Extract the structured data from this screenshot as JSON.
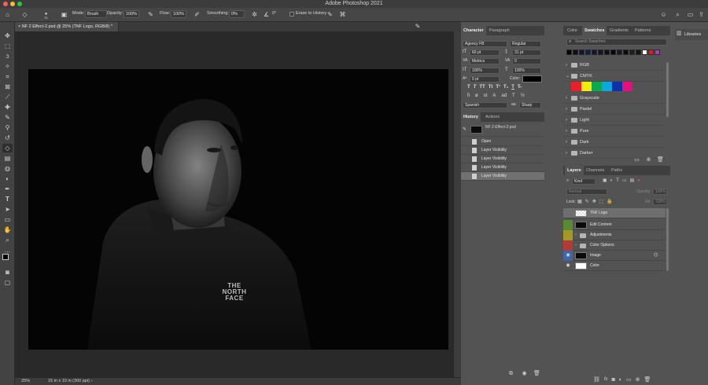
{
  "app": {
    "title": "Adobe Photoshop 2021"
  },
  "options_bar": {
    "brush_size": "70",
    "mode_label": "Mode:",
    "mode_value": "Brush",
    "opacity_label": "Opacity:",
    "opacity_value": "100%",
    "flow_label": "Flow:",
    "flow_value": "100%",
    "smoothing_label": "Smoothing:",
    "smoothing_value": "0%",
    "angle_value": "0°",
    "erase_to_history": "Erase to History"
  },
  "document": {
    "tab_title": "NF 2 Effect-2.psd @ 25% (TNF Logo, RGB/8) *",
    "zoom": "25%",
    "doc_size": "15 in x 10 in (300 ppi)",
    "logo_line1": "THE",
    "logo_line2": "NORTH",
    "logo_line3": "FACE"
  },
  "character_panel": {
    "tabs": [
      "Character",
      "Paragraph"
    ],
    "font_family": "Agency FB",
    "font_style": "Regular",
    "font_size": "60 pt",
    "leading": "31 pt",
    "kerning": "Metrics",
    "tracking": "0",
    "vertical_scale": "100%",
    "horizontal_scale": "100%",
    "baseline_shift": "0 pt",
    "color_label": "Color:",
    "color_value": "#000000",
    "style_buttons": [
      "T",
      "T",
      "TT",
      "Tt",
      "T¹",
      "T₁",
      "T",
      "T̶"
    ],
    "language": "Spanish",
    "anti_alias": "Sharp"
  },
  "history_panel": {
    "tabs": [
      "History",
      "Actions"
    ],
    "snapshot": "NF 2 Effect-2.psd",
    "items": [
      "Open",
      "Layer Visibility",
      "Layer Visibility",
      "Layer Visibility",
      "Layer Visibility"
    ]
  },
  "swatches_panel": {
    "tabs": [
      "Color",
      "Swatches",
      "Gradients",
      "Patterns"
    ],
    "search_placeholder": "Search Swatches",
    "recent_colors": [
      "#000000",
      "#0b0b2a",
      "#12123a",
      "#0d1f4f",
      "#1a0e3a",
      "#13132e",
      "#101010",
      "#050510",
      "#1a1a1a",
      "#0a0a0a",
      "#202020",
      "#141414",
      "#ffffff",
      "#ff1010",
      "#b534c9"
    ],
    "groups": [
      {
        "name": "RGB",
        "expanded": false
      },
      {
        "name": "CMYK",
        "expanded": true,
        "colors": [
          "#e8202a",
          "#f4ec0a",
          "#0aa84f",
          "#09a9e0",
          "#0b33a8",
          "#e4117c"
        ]
      },
      {
        "name": "Grayscale",
        "expanded": false
      },
      {
        "name": "Pastel",
        "expanded": false
      },
      {
        "name": "Light",
        "expanded": false
      },
      {
        "name": "Pure",
        "expanded": false
      },
      {
        "name": "Dark",
        "expanded": false
      },
      {
        "name": "Darker",
        "expanded": false
      }
    ]
  },
  "libraries_panel": {
    "label": "Libraries"
  },
  "layers_panel": {
    "tabs": [
      "Layers",
      "Channels",
      "Paths"
    ],
    "filter_kind": "Kind",
    "blend_mode": "Normal",
    "opacity_label": "Opacity:",
    "opacity_value": "100%",
    "lock_label": "Lock:",
    "fill_label": "Fill:",
    "fill_value": "100%",
    "layers": [
      {
        "name": "TNF Logo",
        "type": "layer",
        "visible": false,
        "tag_color": "",
        "selected": true
      },
      {
        "name": "Edit Content",
        "type": "layer",
        "visible": false,
        "tag_color": "#5a8a34",
        "selected": false
      },
      {
        "name": "Adjustments",
        "type": "group",
        "visible": false,
        "tag_color": "#a39a26",
        "selected": false
      },
      {
        "name": "Color Options",
        "type": "group",
        "visible": false,
        "tag_color": "#b43a36",
        "selected": false
      },
      {
        "name": "Image",
        "type": "layer",
        "visible": true,
        "tag_color": "#3c68a6",
        "selected": false
      },
      {
        "name": "Color",
        "type": "layer",
        "visible": true,
        "tag_color": "",
        "selected": false
      }
    ]
  }
}
